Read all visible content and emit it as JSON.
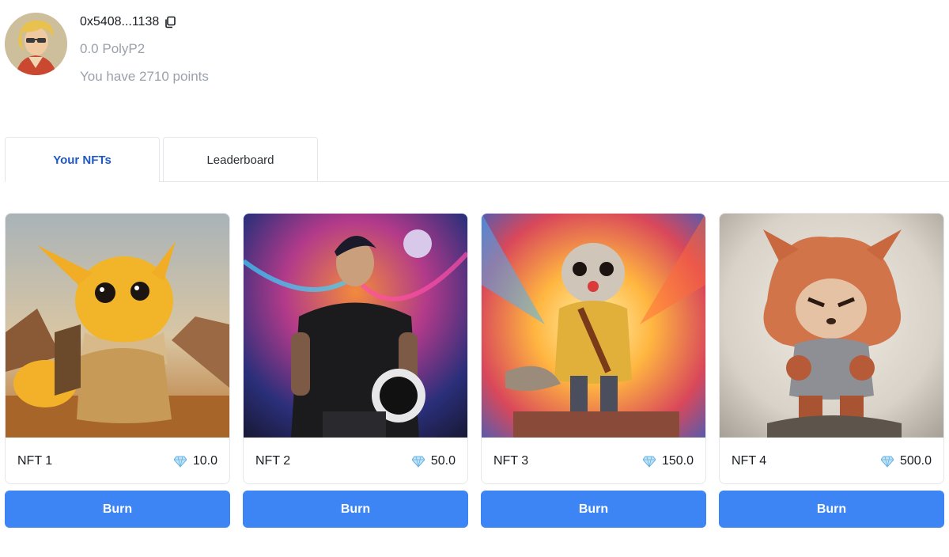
{
  "profile": {
    "address": "0x5408...1138",
    "balance": "0.0 PolyP2",
    "points_text": "You have 2710 points"
  },
  "tabs": [
    {
      "label": "Your NFTs",
      "active": true
    },
    {
      "label": "Leaderboard",
      "active": false
    }
  ],
  "nfts": [
    {
      "name": "NFT 1",
      "price": "10.0",
      "burn_label": "Burn"
    },
    {
      "name": "NFT 2",
      "price": "50.0",
      "burn_label": "Burn"
    },
    {
      "name": "NFT 3",
      "price": "150.0",
      "burn_label": "Burn"
    },
    {
      "name": "NFT 4",
      "price": "500.0",
      "burn_label": "Burn"
    }
  ],
  "colors": {
    "accent": "#3d84f5",
    "active_tab": "#1f58c7",
    "muted_text": "#9aa1ab"
  },
  "icons": {
    "copy": "copy-icon",
    "price": "diamond-icon"
  }
}
